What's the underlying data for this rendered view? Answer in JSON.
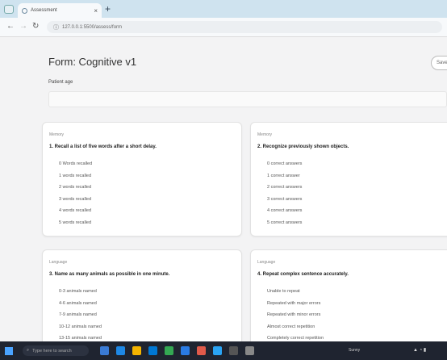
{
  "browser": {
    "tab_title": "Assessment",
    "new_tab_symbol": "+",
    "tab_close_symbol": "×",
    "back_symbol": "←",
    "forward_symbol": "→",
    "reload_symbol": "↻",
    "url": "127.0.0.1:5500/assess/form"
  },
  "page": {
    "title": "Form: Cognitive v1",
    "top_button": "Save",
    "patient_age_label": "Patient age",
    "patient_age_value": ""
  },
  "cards": [
    {
      "category": "Memory",
      "question": "1. Recall a list of five words after a short delay.",
      "options": [
        "0 Words recalled",
        "1 words recalled",
        "2 words recalled",
        "3 words recalled",
        "4 words recalled",
        "5 words recalled"
      ]
    },
    {
      "category": "Memory",
      "question": "2. Recognize previously shown objects.",
      "options": [
        "0 correct answers",
        "1 correct answer",
        "2 correct answers",
        "3 correct answers",
        "4 correct answers",
        "5 correct answers"
      ]
    },
    {
      "category": "Language",
      "question": "3. Name as many animals as possible in one minute.",
      "options": [
        "0-3 animals named",
        "4-6 animals named",
        "7-9 animals named",
        "10-12 animals named",
        "13-15 animals named"
      ]
    },
    {
      "category": "Language",
      "question": "4. Repeat complex sentence accurately.",
      "options": [
        "Unable to repeat",
        "Repeated with major errors",
        "Repeated with minor errors",
        "Almost correct repetition",
        "Completely correct repetition"
      ]
    }
  ],
  "taskbar": {
    "search_placeholder": "Type here to search",
    "weather": "Sunny",
    "icons": [
      "task-view-icon",
      "edge-icon",
      "folder-icon",
      "store-icon",
      "chrome-icon",
      "mail-icon",
      "photos-icon",
      "code-icon",
      "terminal-icon",
      "settings-icon"
    ],
    "icon_colors": [
      "#3a7bd5",
      "#1e88e5",
      "#f4b400",
      "#0078d4",
      "#34a853",
      "#2a7be4",
      "#e05a4a",
      "#2aa4f4",
      "#555555",
      "#888888"
    ]
  }
}
